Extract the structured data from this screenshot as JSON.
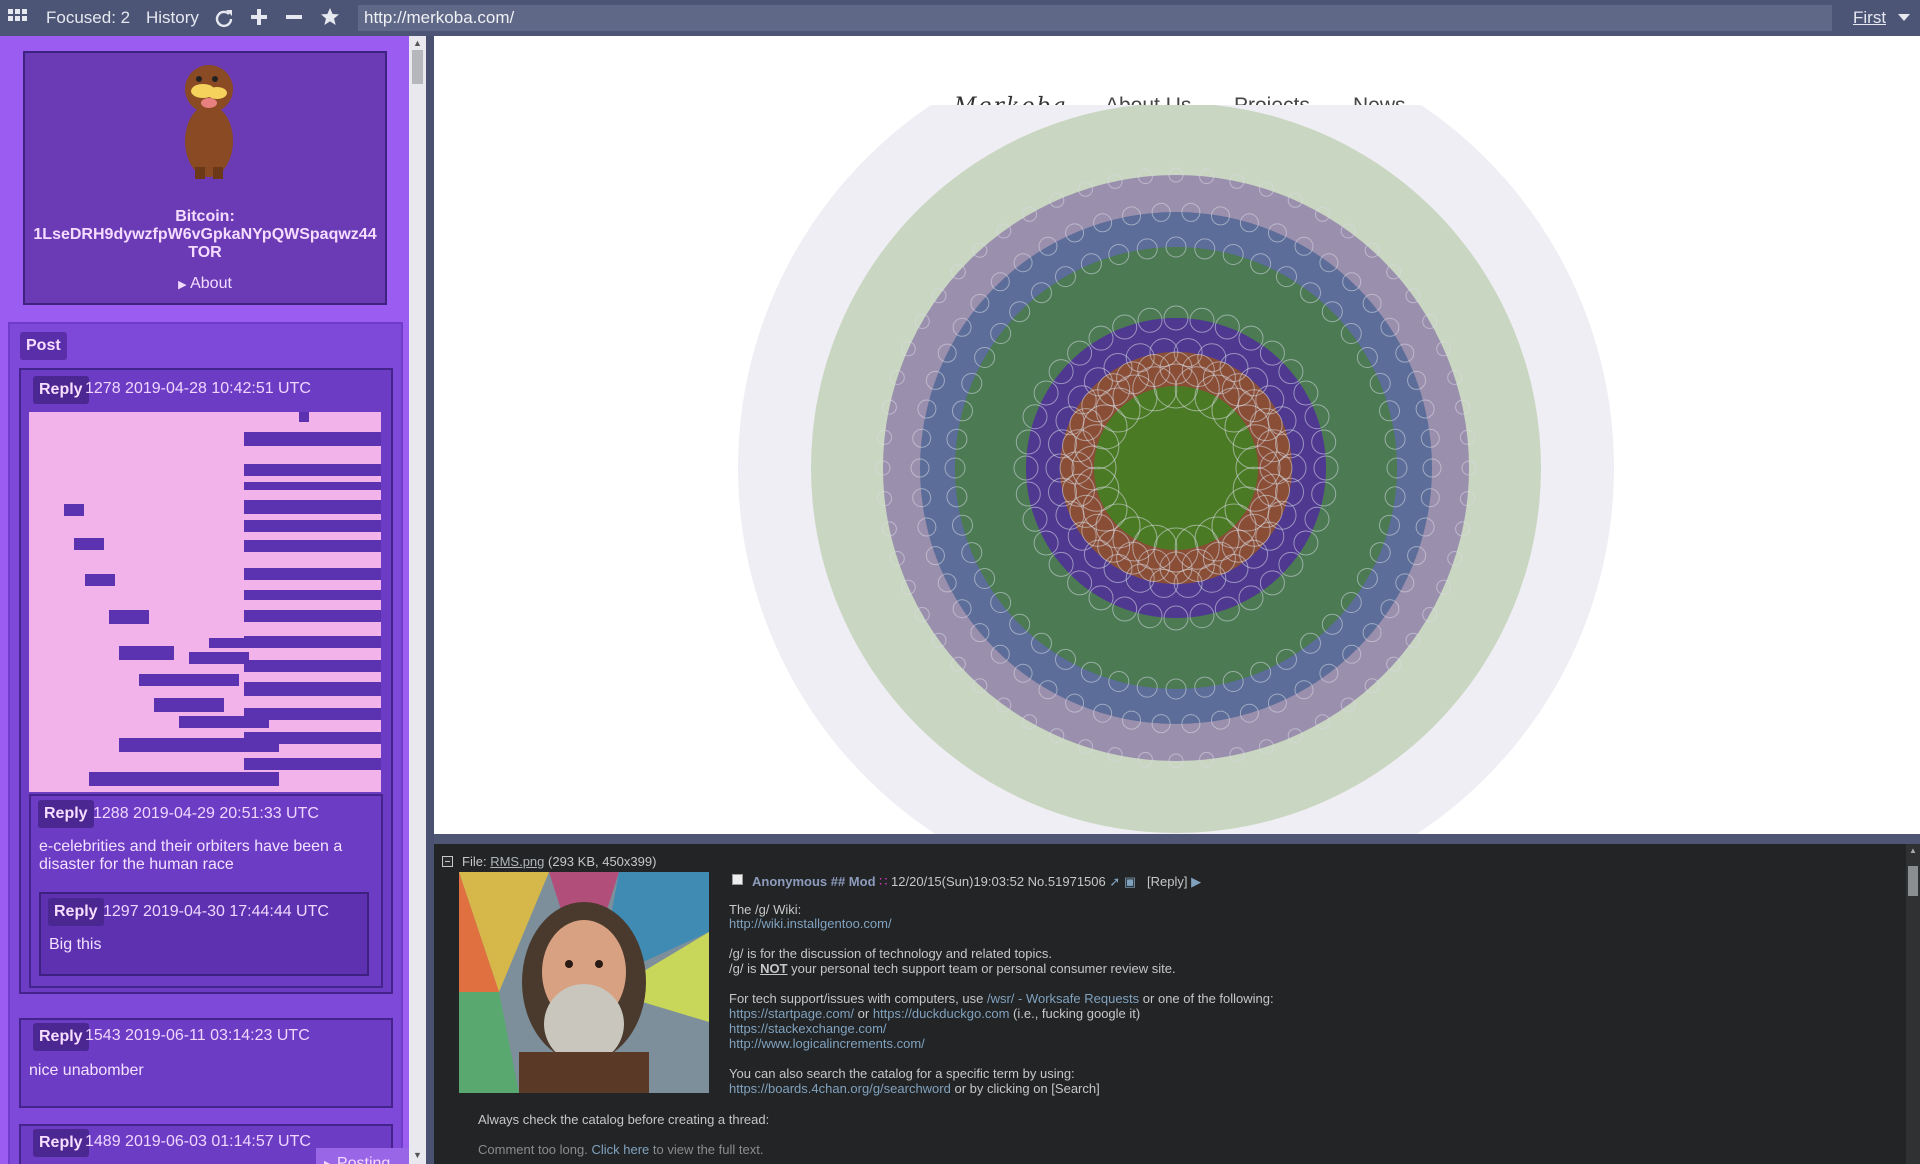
{
  "browser": {
    "focused_label": "Focused: 2",
    "history_label": "History",
    "url": "http://merkoba.com/",
    "first_label": "First"
  },
  "sidebar": {
    "bitcoin_label": "Bitcoin:",
    "bitcoin_address": "1LseDRH9dywzfpW6vGpkaNYpQWSpaqwz44",
    "tor_label": "TOR",
    "about_label": "About",
    "post_button": "Post",
    "posting_label": "Posting",
    "posts": [
      {
        "reply": "Reply",
        "meta": "1278 2019-04-28 10:42:51 UTC"
      },
      {
        "reply": "Reply",
        "meta": "1288 2019-04-29 20:51:33 UTC",
        "text": "e-celebrities and their orbiters have been a disaster for the human race"
      },
      {
        "reply": "Reply",
        "meta": "1297 2019-04-30 17:44:44 UTC",
        "text": "Big this"
      },
      {
        "reply": "Reply",
        "meta": "1543 2019-06-11 03:14:23 UTC",
        "text": "nice unabomber"
      },
      {
        "reply": "Reply",
        "meta": "1489 2019-06-03 01:14:57 UTC"
      }
    ]
  },
  "site": {
    "logo": "Merkoba",
    "nav": [
      "About Us",
      "Projects",
      "News"
    ]
  },
  "thread": {
    "file_label": "File:",
    "file_name": "RMS.png",
    "file_info": "(293 KB, 450x399)",
    "name": "Anonymous ## Mod",
    "datetime": "12/20/15(Sun)19:03:52",
    "number": "No.51971506",
    "reply_link": "[Reply]",
    "lines": [
      "The /g/ Wiki:",
      "http://wiki.installgentoo.com/",
      "/g/ is for the discussion of technology and related topics.",
      "/g/ is",
      "NOT",
      "your personal tech support team or personal consumer review site.",
      "For tech support/issues with computers, use",
      "/wsr/ - Worksafe Requests",
      "or one of the following:",
      "https://startpage.com/",
      "or",
      "https://duckduckgo.com",
      "(i.e., fucking google it)",
      "https://stackexchange.com/",
      "http://www.logicalincrements.com/",
      "You can also search the catalog for a specific term by using:",
      "https://boards.4chan.org/g/searchword",
      "or by clicking on [Search]",
      "Always check the catalog before creating a thread:",
      "Comment too long.",
      "Click here",
      "to view the full text."
    ]
  }
}
